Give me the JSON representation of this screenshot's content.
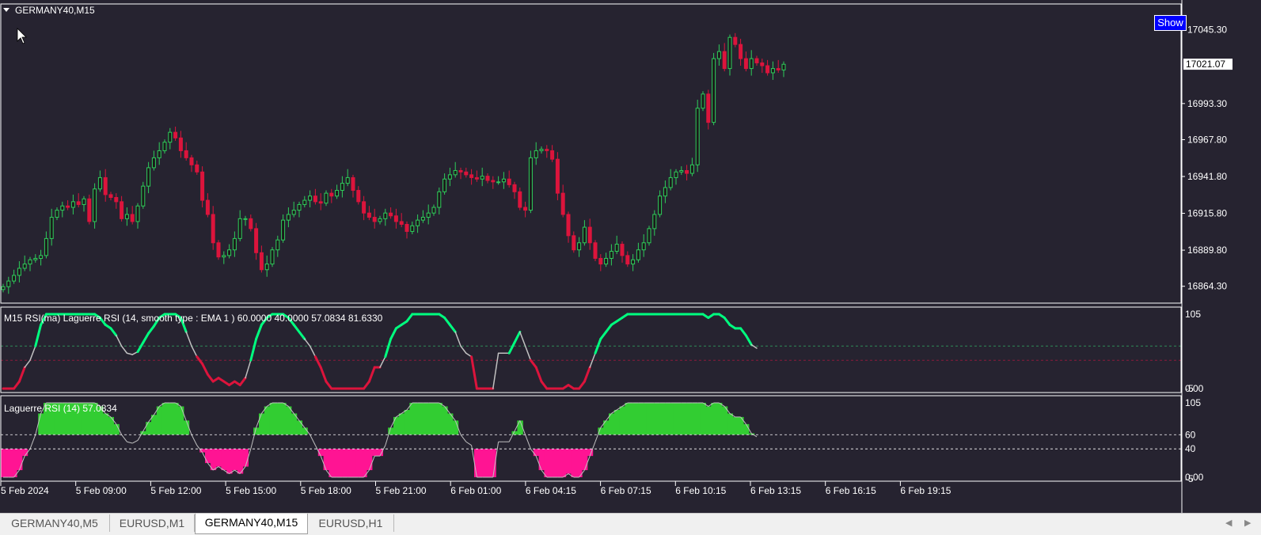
{
  "colors": {
    "background": "#262330",
    "border": "#ffffff",
    "bull_candle": "#2ecc5a",
    "bear_candle": "#dc143c",
    "rsi_up": "#00ff7f",
    "rsi_down": "#dc143c",
    "rsi_neutral": "#c0c0c0",
    "hist_up": "#32cd32",
    "hist_down": "#ff1493",
    "axis_text": "#ffffff",
    "show_button": "#0000ff"
  },
  "window": {
    "title": "GERMANY40,M15",
    "show_button": "Show",
    "current_price_label": "17021.07"
  },
  "tabs": [
    {
      "label": "GERMANY40,M5",
      "active": false
    },
    {
      "label": "EURUSD,M1",
      "active": false
    },
    {
      "label": "GERMANY40,M15",
      "active": true
    },
    {
      "label": "EURUSD,H1",
      "active": false
    }
  ],
  "tab_nav": {
    "left": "◀",
    "right": "▶"
  },
  "chart_data": [
    {
      "type": "candlestick",
      "symbol": "GERMANY40,M15",
      "yticks": [
        "17045.30",
        "16993.30",
        "16967.80",
        "16941.80",
        "16915.80",
        "16889.80",
        "16864.30"
      ],
      "ylim": [
        16858,
        17058
      ],
      "current_price": 17021.07,
      "xticks": [
        "5 Feb 2024",
        "5 Feb 09:00",
        "5 Feb 12:00",
        "5 Feb 15:00",
        "5 Feb 18:00",
        "5 Feb 21:00",
        "6 Feb 01:00",
        "6 Feb 04:15",
        "6 Feb 07:15",
        "6 Feb 10:15",
        "6 Feb 13:15",
        "6 Feb 16:15",
        "6 Feb 19:15"
      ],
      "close": [
        16864,
        16868,
        16872,
        16877,
        16880,
        16883,
        16884,
        16886,
        16898,
        16913,
        16918,
        16921,
        16920,
        16924,
        16922,
        16926,
        16910,
        16933,
        16941,
        16929,
        16927,
        16924,
        16912,
        16915,
        16910,
        16921,
        16935,
        16948,
        16955,
        16960,
        16966,
        16973,
        16969,
        16960,
        16955,
        16950,
        16945,
        16925,
        16915,
        16895,
        16885,
        16886,
        16890,
        16898,
        16912,
        16912,
        16905,
        16888,
        16876,
        16880,
        16890,
        16897,
        16911,
        16915,
        16918,
        16922,
        16925,
        16928,
        16924,
        16923,
        16930,
        16928,
        16932,
        16937,
        16941,
        16932,
        16924,
        16916,
        16913,
        16910,
        16912,
        16916,
        16914,
        16910,
        16908,
        16903,
        16907,
        16911,
        16913,
        16916,
        16920,
        16931,
        16940,
        16943,
        16946,
        16945,
        16943,
        16941,
        16940,
        16942,
        16939,
        16938,
        16938,
        16940,
        16936,
        16931,
        16920,
        16918,
        16955,
        16960,
        16961,
        16960,
        16954,
        16930,
        16915,
        16900,
        16890,
        16895,
        16906,
        16895,
        16884,
        16880,
        16884,
        16889,
        16894,
        16886,
        16880,
        16883,
        16890,
        16895,
        16905,
        16915,
        16928,
        16934,
        16941,
        16945,
        16946,
        16944,
        16950,
        16990,
        17000,
        16980,
        17025,
        17030,
        17018,
        17040,
        17035,
        17025,
        17018,
        17025,
        17022,
        17020,
        17015,
        17018,
        17017,
        17021
      ],
      "title": "",
      "xlabel": "",
      "ylabel": ""
    },
    {
      "type": "line",
      "name": "M15 RSI(ma) Laguerre RSI (14, smooth type : EMA  1 ) 60.0000 40.0000 57.0834 81.6330",
      "levels": [
        60,
        40
      ],
      "ylim": [
        0,
        105
      ],
      "yticks": [
        "105",
        "0.00",
        "-5"
      ],
      "values": [
        0,
        0,
        0,
        10,
        30,
        40,
        60,
        90,
        105,
        105,
        105,
        105,
        105,
        105,
        105,
        105,
        105,
        105,
        100,
        90,
        85,
        75,
        60,
        50,
        48,
        52,
        65,
        78,
        88,
        100,
        105,
        105,
        105,
        100,
        80,
        60,
        45,
        35,
        20,
        10,
        15,
        10,
        5,
        10,
        5,
        15,
        40,
        70,
        90,
        100,
        105,
        105,
        105,
        100,
        90,
        80,
        70,
        60,
        45,
        30,
        10,
        0,
        0,
        0,
        0,
        0,
        0,
        0,
        10,
        30,
        30,
        45,
        70,
        85,
        90,
        95,
        105,
        105,
        105,
        105,
        105,
        105,
        100,
        90,
        80,
        60,
        50,
        45,
        0,
        0,
        0,
        0,
        50,
        50,
        50,
        65,
        80,
        60,
        40,
        30,
        10,
        0,
        0,
        0,
        0,
        5,
        0,
        0,
        10,
        30,
        50,
        70,
        80,
        90,
        95,
        100,
        105,
        105,
        105,
        105,
        105,
        105,
        105,
        105,
        105,
        105,
        105,
        105,
        105,
        105,
        105,
        100,
        105,
        105,
        100,
        90,
        85,
        85,
        75,
        62,
        57
      ]
    },
    {
      "type": "area",
      "name": "Laguerre RSI (14) 57.0834",
      "levels": [
        60,
        40
      ],
      "ylim": [
        0,
        105
      ],
      "yticks": [
        "105",
        "60",
        "40",
        "0.00",
        "-5"
      ],
      "values": [
        0,
        0,
        0,
        10,
        30,
        40,
        60,
        90,
        105,
        105,
        105,
        105,
        105,
        105,
        105,
        105,
        105,
        105,
        100,
        90,
        85,
        75,
        60,
        50,
        48,
        52,
        65,
        78,
        88,
        100,
        105,
        105,
        105,
        100,
        80,
        60,
        45,
        35,
        20,
        10,
        15,
        10,
        5,
        10,
        5,
        15,
        40,
        70,
        90,
        100,
        105,
        105,
        105,
        100,
        90,
        80,
        70,
        60,
        45,
        30,
        10,
        0,
        0,
        0,
        0,
        0,
        0,
        0,
        10,
        30,
        30,
        45,
        70,
        85,
        90,
        95,
        105,
        105,
        105,
        105,
        105,
        105,
        100,
        90,
        80,
        60,
        50,
        45,
        0,
        0,
        0,
        0,
        50,
        50,
        50,
        65,
        80,
        60,
        40,
        30,
        10,
        0,
        0,
        0,
        0,
        5,
        0,
        0,
        10,
        30,
        50,
        70,
        80,
        90,
        95,
        100,
        105,
        105,
        105,
        105,
        105,
        105,
        105,
        105,
        105,
        105,
        105,
        105,
        105,
        105,
        105,
        100,
        105,
        105,
        100,
        90,
        85,
        85,
        75,
        62,
        57
      ]
    }
  ]
}
